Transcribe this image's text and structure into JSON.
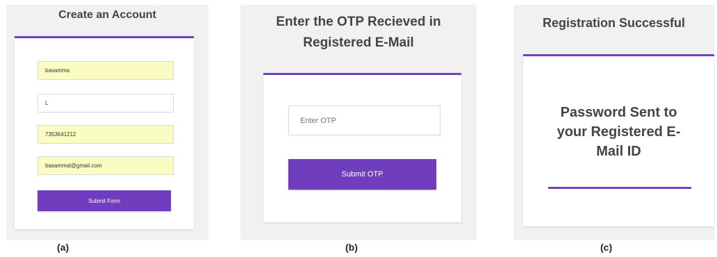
{
  "accent_color": "#6f42c1",
  "panel_a": {
    "title": "Create an Account",
    "fields": [
      "basamma",
      "L",
      "7353641212",
      "basammal@gmail.com"
    ],
    "submit_label": "Submit Form",
    "caption": "(a)"
  },
  "panel_b": {
    "title_line1": "Enter the OTP Recieved in",
    "title_line2": "Registered E-Mail",
    "otp_placeholder": "Enter OTP",
    "submit_label": "Submit OTP",
    "caption": "(b)"
  },
  "panel_c": {
    "title": "Registration Successful",
    "message_line1": "Password Sent to",
    "message_line2": "your Registered E-",
    "message_line3": "Mail ID",
    "caption": "(c)"
  }
}
